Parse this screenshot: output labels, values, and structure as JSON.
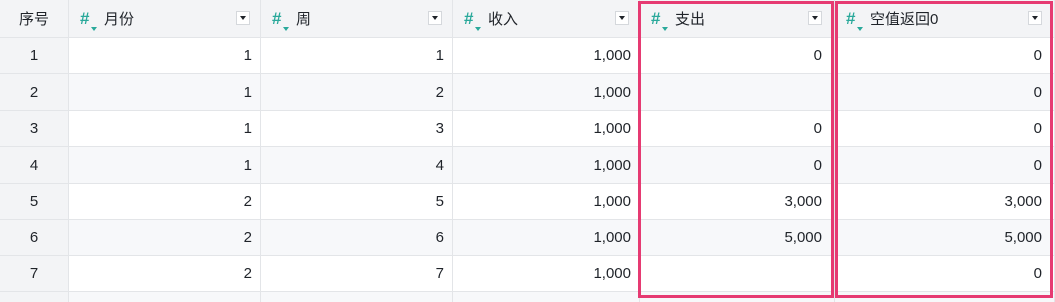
{
  "header": {
    "index_label": "序号",
    "columns": [
      {
        "label": "月份",
        "type_icon": "number-hash-icon"
      },
      {
        "label": "周",
        "type_icon": "number-hash-icon"
      },
      {
        "label": "收入",
        "type_icon": "number-hash-icon"
      },
      {
        "label": "支出",
        "type_icon": "number-hash-icon"
      },
      {
        "label": "空值返回0",
        "type_icon": "number-hash-icon"
      }
    ]
  },
  "rows": [
    {
      "index": "1",
      "cells": [
        "1",
        "1",
        "1,000",
        "0",
        "0"
      ]
    },
    {
      "index": "2",
      "cells": [
        "1",
        "2",
        "1,000",
        "",
        "0"
      ]
    },
    {
      "index": "3",
      "cells": [
        "1",
        "3",
        "1,000",
        "0",
        "0"
      ]
    },
    {
      "index": "4",
      "cells": [
        "1",
        "4",
        "1,000",
        "0",
        "0"
      ]
    },
    {
      "index": "5",
      "cells": [
        "2",
        "5",
        "1,000",
        "3,000",
        "3,000"
      ]
    },
    {
      "index": "6",
      "cells": [
        "2",
        "6",
        "1,000",
        "5,000",
        "5,000"
      ]
    },
    {
      "index": "7",
      "cells": [
        "2",
        "7",
        "1,000",
        "",
        "0"
      ]
    }
  ],
  "highlight_color": "#e63a72",
  "accent_color": "#2aa99b"
}
